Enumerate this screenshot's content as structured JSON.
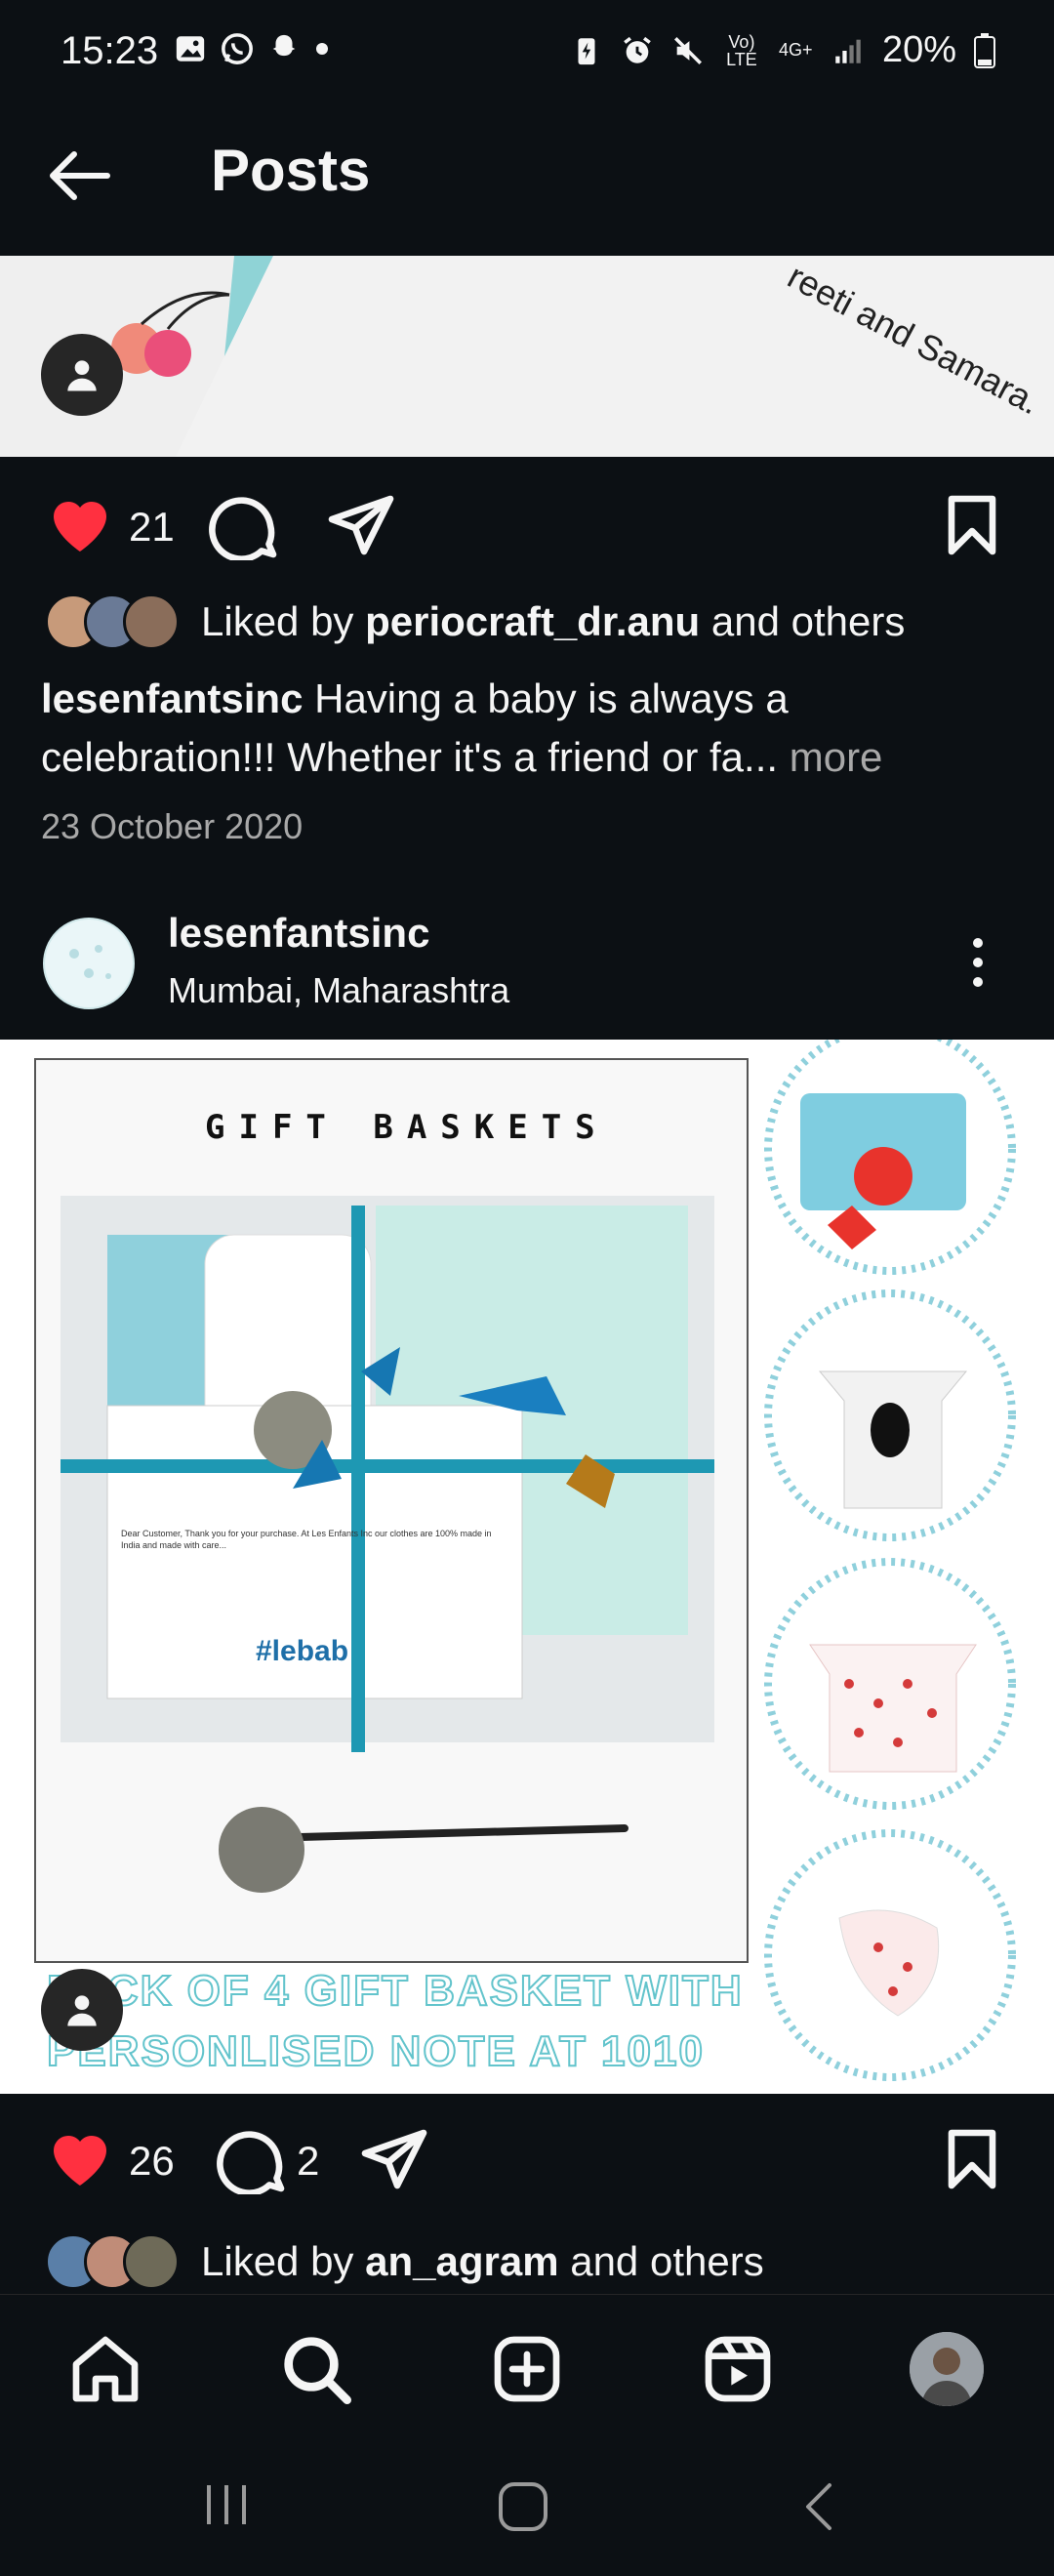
{
  "status_bar": {
    "time": "15:23",
    "network": "Vo) LTE",
    "net_type": "4G+",
    "battery": "20%"
  },
  "header": {
    "title": "Posts"
  },
  "post1": {
    "image_text": "reeti and Samara.",
    "likes": "21",
    "liked_by_prefix": "Liked by",
    "liked_by_user": "periocraft_dr.anu",
    "liked_by_suffix": "and others",
    "caption_user": "lesenfantsinc",
    "caption_text": "Having a baby is always a celebration!!! Whether it's a friend or fa...",
    "more_label": "more",
    "date": "23 October 2020"
  },
  "post2": {
    "username": "lesenfantsinc",
    "location": "Mumbai, Maharashtra",
    "image": {
      "heading": "GIFT BASKETS",
      "hashtag": "#lebab",
      "note_text": "Dear Customer, Thank you for your purchase. At Les Enfants Inc our clothes are 100% made in India and made with care...",
      "footer_line1": "PACK OF 4 GIFT BASKET WITH",
      "footer_line2": "PERSONLISED NOTE AT 1010"
    },
    "likes": "26",
    "comments": "2",
    "liked_by_prefix": "Liked by",
    "liked_by_user": "an_agram",
    "liked_by_suffix": "and others"
  },
  "colors": {
    "background": "#0c1014",
    "like_red": "#ff3040",
    "secondary_text": "#a8a8a8",
    "teal": "#6fc7cc"
  },
  "icons": {
    "nav": [
      "home-icon",
      "search-icon",
      "create-icon",
      "reels-icon",
      "profile-avatar"
    ]
  }
}
